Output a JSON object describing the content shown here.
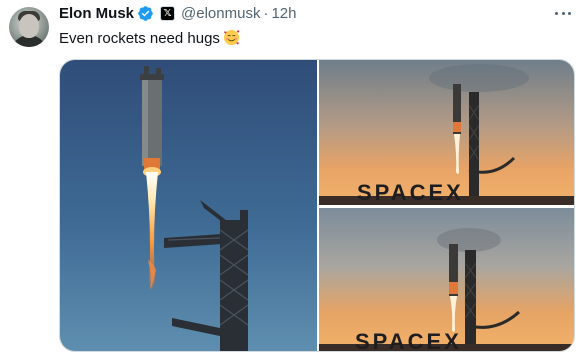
{
  "tweet": {
    "author_name": "Elon Musk",
    "handle": "@elonmusk",
    "separator": "·",
    "time": "12h",
    "text": "Even rockets need hugs",
    "emoji": "smiling-face-with-hearts",
    "verified_color": "#1d9bf0",
    "x_badge": "𝕏"
  },
  "media": {
    "images": [
      {
        "name": "rocket-tower-closeup"
      },
      {
        "name": "rocket-tower-sunset-spacex"
      },
      {
        "name": "rocket-tower-sunset-spacex-catch"
      }
    ],
    "watermark": "SPACEX"
  },
  "colors": {
    "text_primary": "#0f1419",
    "text_secondary": "#536471",
    "border": "#cfd9de"
  }
}
